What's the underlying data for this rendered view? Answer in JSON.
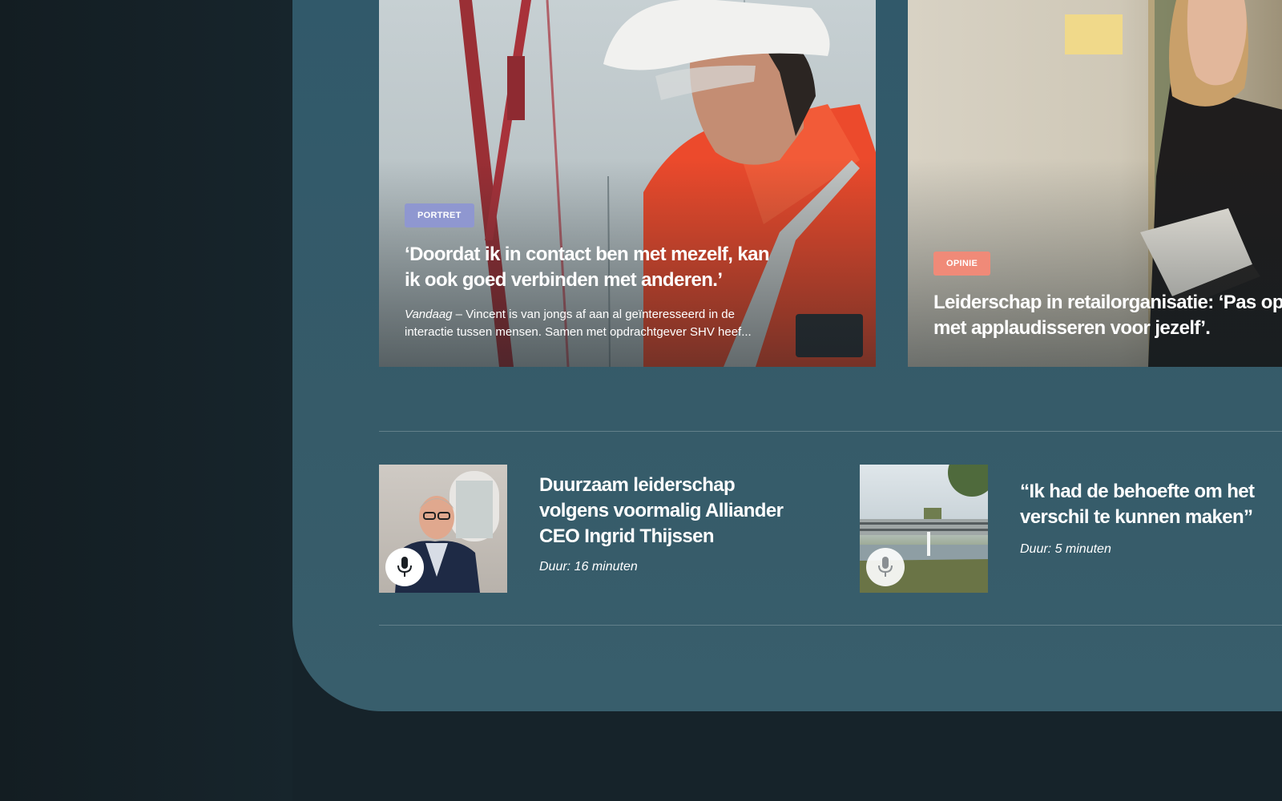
{
  "colors": {
    "page_background": "#16232a",
    "panel_background": "#355b69",
    "tag_portret": "#8f97d0",
    "tag_opinie": "#f08a78",
    "text": "#ffffff"
  },
  "features": [
    {
      "tag": "PORTRET",
      "title": "‘Doordat ik in contact ben met mezelf, kan ik ook goed verbinden met anderen.’",
      "excerpt_source": "Vandaag",
      "excerpt_text": " – Vincent is van jongs af aan al geïnteresseerd in de interactie tussen mensen. Samen met opdrachtgever SHV heef..."
    },
    {
      "tag": "OPINIE",
      "title": "Leiderschap in retailorganisatie: ‘Pas op met applaudisseren voor jezelf’."
    }
  ],
  "podcasts": [
    {
      "title": "Duurzaam leiderschap volgens voormalig Alliander CEO Ingrid Thijssen",
      "duration": "Duur: 16 minuten",
      "icon": "microphone-icon"
    },
    {
      "title": "“Ik had de behoefte om het verschil te kunnen maken”",
      "duration": "Duur: 5 minuten",
      "icon": "microphone-icon"
    }
  ]
}
